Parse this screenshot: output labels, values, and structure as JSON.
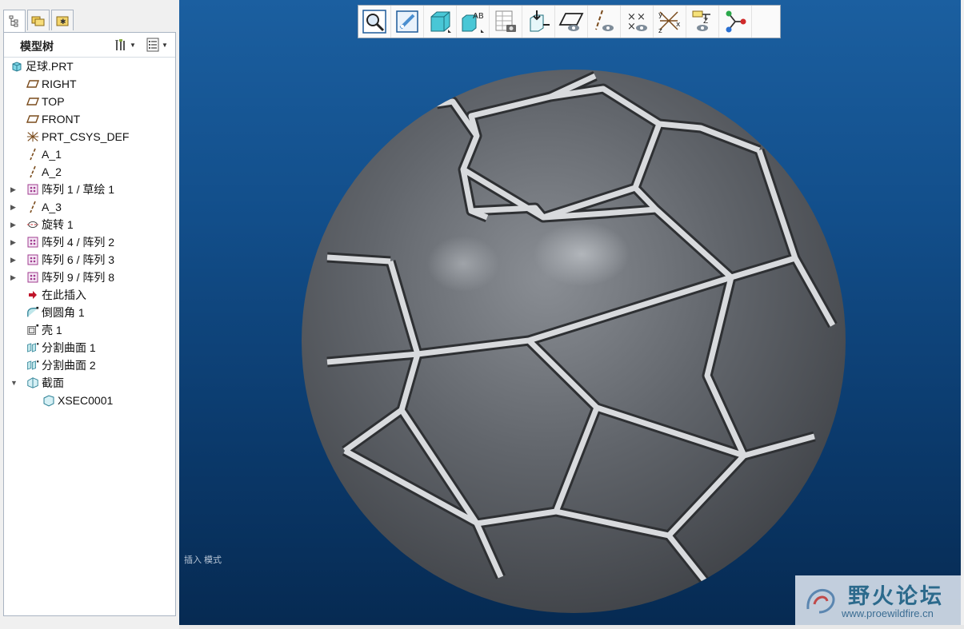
{
  "left_panel": {
    "tabs": [
      {
        "name": "model-tree-tab-icon",
        "active": true
      },
      {
        "name": "folder-browser-tab-icon",
        "active": false
      },
      {
        "name": "favorites-tab-icon",
        "active": false
      }
    ],
    "tree_title": "模型树",
    "settings_icon": "tree-settings-icon",
    "columns_icon": "tree-columns-icon"
  },
  "tree": [
    {
      "label": "足球.PRT",
      "icon": "part-icon",
      "expander": "",
      "indent": 8
    },
    {
      "label": "RIGHT",
      "icon": "datum-plane-icon",
      "expander": "",
      "indent": 28
    },
    {
      "label": "TOP",
      "icon": "datum-plane-icon",
      "expander": "",
      "indent": 28
    },
    {
      "label": "FRONT",
      "icon": "datum-plane-icon",
      "expander": "",
      "indent": 28
    },
    {
      "label": "PRT_CSYS_DEF",
      "icon": "coordinate-system-icon",
      "expander": "",
      "indent": 28
    },
    {
      "label": "A_1",
      "icon": "datum-axis-icon",
      "expander": "",
      "indent": 28
    },
    {
      "label": "A_2",
      "icon": "datum-axis-icon",
      "expander": "",
      "indent": 28
    },
    {
      "label": "阵列 1 / 草绘 1",
      "icon": "pattern-icon",
      "expander": "▶",
      "indent": 28
    },
    {
      "label": "A_3",
      "icon": "datum-axis-icon",
      "expander": "▶",
      "indent": 28
    },
    {
      "label": "旋转 1",
      "icon": "revolve-icon",
      "expander": "▶",
      "indent": 28
    },
    {
      "label": "阵列 4 / 阵列 2",
      "icon": "pattern-icon",
      "expander": "▶",
      "indent": 28
    },
    {
      "label": "阵列 6 / 阵列 3",
      "icon": "pattern-icon",
      "expander": "▶",
      "indent": 28
    },
    {
      "label": "阵列 9 / 阵列 8",
      "icon": "pattern-icon",
      "expander": "▶",
      "indent": 28
    },
    {
      "label": "在此插入",
      "icon": "insert-here-arrow-icon",
      "expander": "",
      "indent": 28
    },
    {
      "label": "倒圆角 1",
      "icon": "round-icon",
      "expander": "",
      "indent": 28
    },
    {
      "label": "壳 1",
      "icon": "shell-icon",
      "expander": "",
      "indent": 28
    },
    {
      "label": "分割曲面 1",
      "icon": "split-surface-icon",
      "expander": "",
      "indent": 28
    },
    {
      "label": "分割曲面 2",
      "icon": "split-surface-icon",
      "expander": "",
      "indent": 28
    },
    {
      "label": "截面",
      "icon": "section-icon",
      "expander": "▼",
      "indent": 28
    },
    {
      "label": "XSEC0001",
      "icon": "section-item-icon",
      "expander": "",
      "indent": 48
    }
  ],
  "toolbar": [
    {
      "name": "refit-zoom-icon"
    },
    {
      "name": "repaint-icon"
    },
    {
      "name": "shading-mode-icon"
    },
    {
      "name": "saved-views-icon"
    },
    {
      "name": "view-manager-icon"
    },
    {
      "name": "annotation-orientation-icon"
    },
    {
      "name": "datum-plane-display-icon"
    },
    {
      "name": "datum-axis-display-icon"
    },
    {
      "name": "datum-point-display-icon"
    },
    {
      "name": "csys-display-icon"
    },
    {
      "name": "annotation-display-icon"
    },
    {
      "name": "spin-center-icon"
    }
  ],
  "viewport": {
    "mode_text": "插入 模式",
    "watermark_brand": "野火论坛",
    "watermark_url": "www.proewildfire.cn"
  }
}
